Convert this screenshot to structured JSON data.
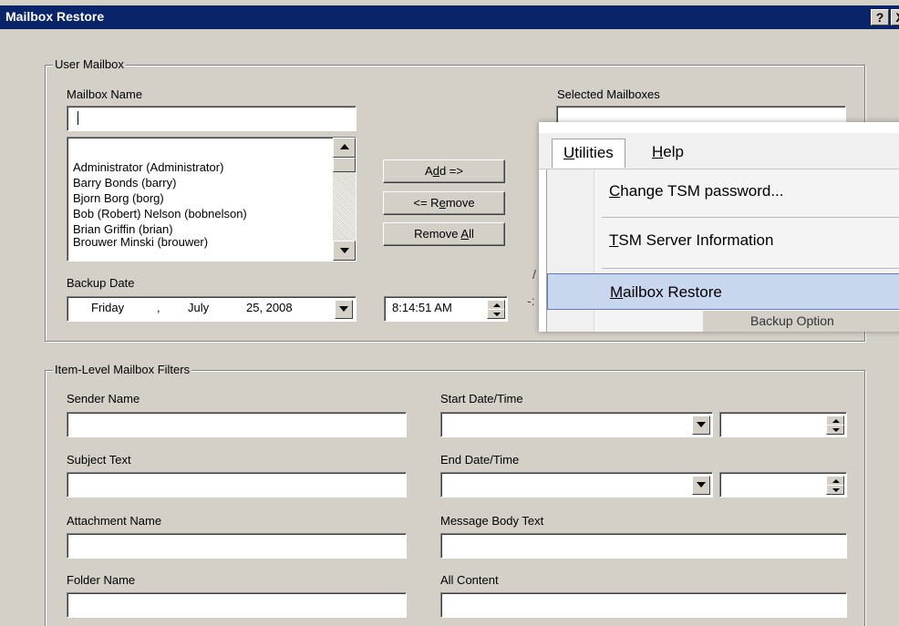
{
  "titlebar": {
    "title": "Mailbox Restore",
    "help_glyph": "?",
    "close_glyph": "X"
  },
  "user_mailbox": {
    "legend": "User Mailbox",
    "mailbox_name_label": "Mailbox Name",
    "mailbox_name_value": "",
    "selected_mailboxes_label": "Selected Mailboxes",
    "list_items": [
      "Administrator (Administrator)",
      "Barry Bonds (barry)",
      "Bjorn Borg (borg)",
      "Bob (Robert) Nelson (bobnelson)",
      "Brian Griffin (brian)",
      "Brouwer Minski (brouwer)"
    ],
    "buttons": {
      "add_prefix": "A",
      "add_ul": "d",
      "add_suffix": "d =>",
      "remove_prefix": "<= R",
      "remove_ul": "e",
      "remove_suffix": "move",
      "removeall_prefix": "Remove ",
      "removeall_ul": "A",
      "removeall_suffix": "ll"
    },
    "backup_date_label": "Backup Date",
    "backup_date": {
      "weekday": "Friday",
      "sep": ",",
      "month": "July",
      "day_year": "25, 2008"
    },
    "backup_time": "8:14:51 AM"
  },
  "filters": {
    "legend": "Item-Level Mailbox Filters",
    "sender_name_label": "Sender Name",
    "subject_text_label": "Subject Text",
    "attachment_name_label": "Attachment Name",
    "folder_name_label": "Folder Name",
    "start_datetime_label": "Start Date/Time",
    "end_datetime_label": "End Date/Time",
    "message_body_label": "Message Body Text",
    "all_content_label": "All Content"
  },
  "menu": {
    "utilities_ul": "U",
    "utilities_rest": "tilities",
    "help_ul": "H",
    "help_rest": "elp",
    "item1_ul": "C",
    "item1_rest": "hange TSM password...",
    "item2_ul": "T",
    "item2_rest": "SM Server Information",
    "item3_ul": "M",
    "item3_rest": "ailbox Restore",
    "behind_text": "Backup Option",
    "behind_fragment_1": "/",
    "behind_fragment_2": "-:"
  },
  "colors": {
    "titlebar": "#0a246a",
    "dialog_bg": "#d4d0c8",
    "menu_highlight": "#c8d6ee"
  }
}
